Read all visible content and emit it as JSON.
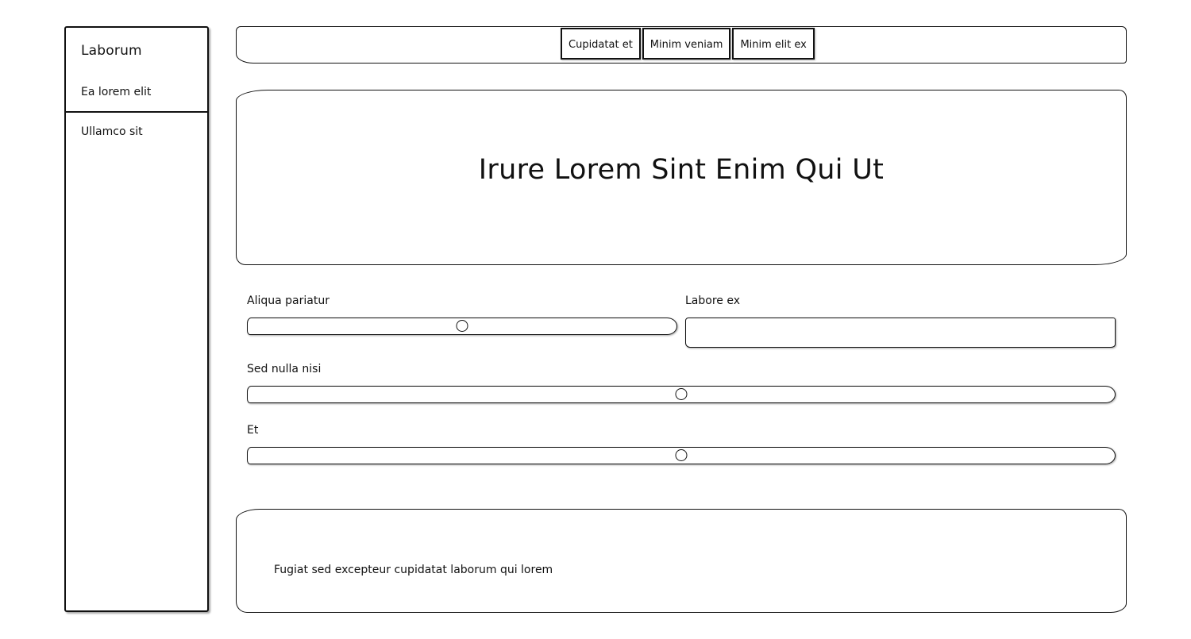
{
  "sidebar": {
    "brand": "Laborum",
    "items": [
      {
        "label": "Ea lorem elit"
      },
      {
        "label": "Ullamco sit"
      }
    ]
  },
  "tabs": [
    {
      "label": "Cupidatat et"
    },
    {
      "label": "Minim veniam"
    },
    {
      "label": "Minim elit ex"
    }
  ],
  "hero": {
    "title": "Irure Lorem Sint Enim Qui Ut"
  },
  "form": {
    "slider_1": {
      "label": "Aliqua pariatur",
      "value": 0.5
    },
    "text_input": {
      "label": "Labore ex",
      "value": "",
      "placeholder": ""
    },
    "slider_2": {
      "label": "Sed nulla nisi",
      "value": 0.5
    },
    "slider_3": {
      "label": "Et",
      "value": 0.5
    }
  },
  "footer": {
    "text": "Fugiat sed excepteur cupidatat laborum qui lorem"
  }
}
